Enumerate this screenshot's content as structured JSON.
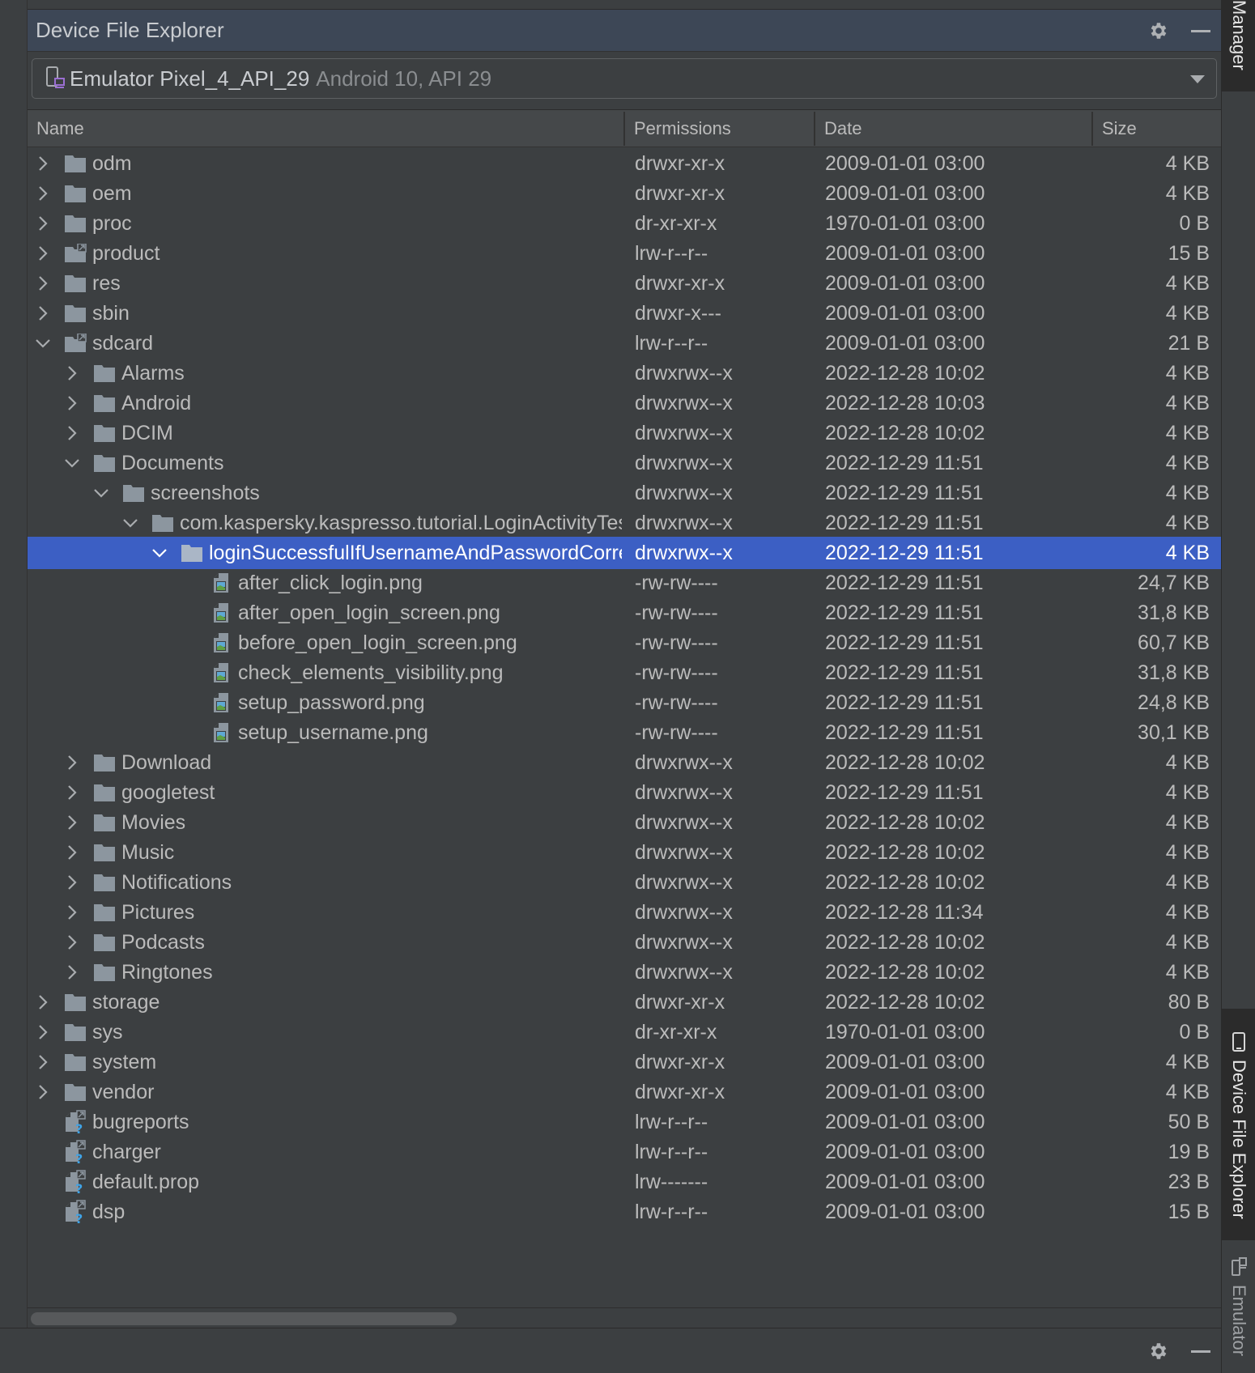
{
  "panel": {
    "title": "Device File Explorer",
    "settings_icon": "gear-icon",
    "hide_icon": "minimize-icon"
  },
  "device_selector": {
    "device_name": "Emulator Pixel_4_API_29",
    "device_detail": "Android 10, API 29",
    "icon": "device-emulator-icon"
  },
  "columns": {
    "name": "Name",
    "permissions": "Permissions",
    "date": "Date",
    "size": "Size"
  },
  "rows": [
    {
      "name": "odm",
      "depth": 0,
      "type": "folder",
      "expander": "collapsed",
      "permissions": "drwxr-xr-x",
      "date": "2009-01-01 03:00",
      "size": "4 KB"
    },
    {
      "name": "oem",
      "depth": 0,
      "type": "folder",
      "expander": "collapsed",
      "permissions": "drwxr-xr-x",
      "date": "2009-01-01 03:00",
      "size": "4 KB"
    },
    {
      "name": "proc",
      "depth": 0,
      "type": "folder",
      "expander": "collapsed",
      "permissions": "dr-xr-xr-x",
      "date": "1970-01-01 03:00",
      "size": "0 B"
    },
    {
      "name": "product",
      "depth": 0,
      "type": "folder-link",
      "expander": "collapsed",
      "permissions": "lrw-r--r--",
      "date": "2009-01-01 03:00",
      "size": "15 B"
    },
    {
      "name": "res",
      "depth": 0,
      "type": "folder",
      "expander": "collapsed",
      "permissions": "drwxr-xr-x",
      "date": "2009-01-01 03:00",
      "size": "4 KB"
    },
    {
      "name": "sbin",
      "depth": 0,
      "type": "folder",
      "expander": "collapsed",
      "permissions": "drwxr-x---",
      "date": "2009-01-01 03:00",
      "size": "4 KB"
    },
    {
      "name": "sdcard",
      "depth": 0,
      "type": "folder-link",
      "expander": "expanded",
      "permissions": "lrw-r--r--",
      "date": "2009-01-01 03:00",
      "size": "21 B"
    },
    {
      "name": "Alarms",
      "depth": 1,
      "type": "folder",
      "expander": "collapsed",
      "permissions": "drwxrwx--x",
      "date": "2022-12-28 10:02",
      "size": "4 KB"
    },
    {
      "name": "Android",
      "depth": 1,
      "type": "folder",
      "expander": "collapsed",
      "permissions": "drwxrwx--x",
      "date": "2022-12-28 10:03",
      "size": "4 KB"
    },
    {
      "name": "DCIM",
      "depth": 1,
      "type": "folder",
      "expander": "collapsed",
      "permissions": "drwxrwx--x",
      "date": "2022-12-28 10:02",
      "size": "4 KB"
    },
    {
      "name": "Documents",
      "depth": 1,
      "type": "folder",
      "expander": "expanded",
      "permissions": "drwxrwx--x",
      "date": "2022-12-29 11:51",
      "size": "4 KB"
    },
    {
      "name": "screenshots",
      "depth": 2,
      "type": "folder",
      "expander": "expanded",
      "permissions": "drwxrwx--x",
      "date": "2022-12-29 11:51",
      "size": "4 KB"
    },
    {
      "name": "com.kaspersky.kaspresso.tutorial.LoginActivityTest",
      "depth": 3,
      "type": "folder",
      "expander": "expanded",
      "permissions": "drwxrwx--x",
      "date": "2022-12-29 11:51",
      "size": "4 KB"
    },
    {
      "name": "loginSuccessfulIfUsernameAndPasswordCorrect",
      "depth": 4,
      "type": "folder",
      "expander": "expanded",
      "permissions": "drwxrwx--x",
      "date": "2022-12-29 11:51",
      "size": "4 KB",
      "selected": true
    },
    {
      "name": "after_click_login.png",
      "depth": 5,
      "type": "image",
      "expander": "none",
      "permissions": "-rw-rw----",
      "date": "2022-12-29 11:51",
      "size": "24,7 KB"
    },
    {
      "name": "after_open_login_screen.png",
      "depth": 5,
      "type": "image",
      "expander": "none",
      "permissions": "-rw-rw----",
      "date": "2022-12-29 11:51",
      "size": "31,8 KB"
    },
    {
      "name": "before_open_login_screen.png",
      "depth": 5,
      "type": "image",
      "expander": "none",
      "permissions": "-rw-rw----",
      "date": "2022-12-29 11:51",
      "size": "60,7 KB"
    },
    {
      "name": "check_elements_visibility.png",
      "depth": 5,
      "type": "image",
      "expander": "none",
      "permissions": "-rw-rw----",
      "date": "2022-12-29 11:51",
      "size": "31,8 KB"
    },
    {
      "name": "setup_password.png",
      "depth": 5,
      "type": "image",
      "expander": "none",
      "permissions": "-rw-rw----",
      "date": "2022-12-29 11:51",
      "size": "24,8 KB"
    },
    {
      "name": "setup_username.png",
      "depth": 5,
      "type": "image",
      "expander": "none",
      "permissions": "-rw-rw----",
      "date": "2022-12-29 11:51",
      "size": "30,1 KB"
    },
    {
      "name": "Download",
      "depth": 1,
      "type": "folder",
      "expander": "collapsed",
      "permissions": "drwxrwx--x",
      "date": "2022-12-28 10:02",
      "size": "4 KB"
    },
    {
      "name": "googletest",
      "depth": 1,
      "type": "folder",
      "expander": "collapsed",
      "permissions": "drwxrwx--x",
      "date": "2022-12-29 11:51",
      "size": "4 KB"
    },
    {
      "name": "Movies",
      "depth": 1,
      "type": "folder",
      "expander": "collapsed",
      "permissions": "drwxrwx--x",
      "date": "2022-12-28 10:02",
      "size": "4 KB"
    },
    {
      "name": "Music",
      "depth": 1,
      "type": "folder",
      "expander": "collapsed",
      "permissions": "drwxrwx--x",
      "date": "2022-12-28 10:02",
      "size": "4 KB"
    },
    {
      "name": "Notifications",
      "depth": 1,
      "type": "folder",
      "expander": "collapsed",
      "permissions": "drwxrwx--x",
      "date": "2022-12-28 10:02",
      "size": "4 KB"
    },
    {
      "name": "Pictures",
      "depth": 1,
      "type": "folder",
      "expander": "collapsed",
      "permissions": "drwxrwx--x",
      "date": "2022-12-28 11:34",
      "size": "4 KB"
    },
    {
      "name": "Podcasts",
      "depth": 1,
      "type": "folder",
      "expander": "collapsed",
      "permissions": "drwxrwx--x",
      "date": "2022-12-28 10:02",
      "size": "4 KB"
    },
    {
      "name": "Ringtones",
      "depth": 1,
      "type": "folder",
      "expander": "collapsed",
      "permissions": "drwxrwx--x",
      "date": "2022-12-28 10:02",
      "size": "4 KB"
    },
    {
      "name": "storage",
      "depth": 0,
      "type": "folder",
      "expander": "collapsed",
      "permissions": "drwxr-xr-x",
      "date": "2022-12-28 10:02",
      "size": "80 B"
    },
    {
      "name": "sys",
      "depth": 0,
      "type": "folder",
      "expander": "collapsed",
      "permissions": "dr-xr-xr-x",
      "date": "1970-01-01 03:00",
      "size": "0 B"
    },
    {
      "name": "system",
      "depth": 0,
      "type": "folder",
      "expander": "collapsed",
      "permissions": "drwxr-xr-x",
      "date": "2009-01-01 03:00",
      "size": "4 KB"
    },
    {
      "name": "vendor",
      "depth": 0,
      "type": "folder",
      "expander": "collapsed",
      "permissions": "drwxr-xr-x",
      "date": "2009-01-01 03:00",
      "size": "4 KB"
    },
    {
      "name": "bugreports",
      "depth": 0,
      "type": "unknown-link",
      "expander": "none",
      "permissions": "lrw-r--r--",
      "date": "2009-01-01 03:00",
      "size": "50 B"
    },
    {
      "name": "charger",
      "depth": 0,
      "type": "unknown-link",
      "expander": "none",
      "permissions": "lrw-r--r--",
      "date": "2009-01-01 03:00",
      "size": "19 B"
    },
    {
      "name": "default.prop",
      "depth": 0,
      "type": "unknown-link",
      "expander": "none",
      "permissions": "lrw-------",
      "date": "2009-01-01 03:00",
      "size": "23 B"
    },
    {
      "name": "dsp",
      "depth": 0,
      "type": "unknown-link",
      "expander": "none",
      "permissions": "lrw-r--r--",
      "date": "2009-01-01 03:00",
      "size": "15 B"
    }
  ],
  "side_tabs": {
    "top": "Manager",
    "device_file_explorer": "Device File Explorer",
    "emulator": "Emulator"
  },
  "colors": {
    "selection": "#3c5fc4",
    "titlebar": "#3d4756",
    "folder_icon": "#8c969f",
    "image_icon_green": "#5fa046",
    "image_icon_blue": "#5fa8d3",
    "unknown_icon_blue": "#3fa3e6"
  }
}
